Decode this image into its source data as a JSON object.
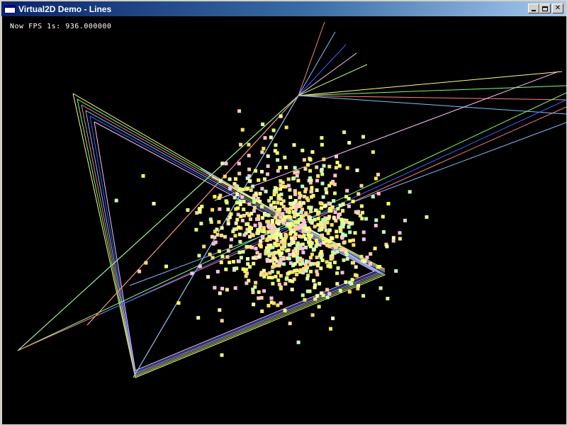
{
  "window": {
    "title": "Virtual2D Demo - Lines",
    "icon": "app-window-icon",
    "buttons": {
      "minimize": "minimize-icon",
      "maximize": "maximize-icon",
      "close": "close-icon"
    }
  },
  "overlay": {
    "fps_text": "Now FPS 1s: 936.000000"
  },
  "colors": {
    "background": "#000000",
    "text": "#ffffff",
    "line_palette": [
      "#ffff80",
      "#80ff80",
      "#ff8080",
      "#80c0ff",
      "#4060ff",
      "#ffc0ff",
      "#c0ff80"
    ],
    "particle_palette": [
      "#ffff66",
      "#ffffaa",
      "#e0ff80",
      "#ffd0a0",
      "#ffc0e0",
      "#c0ffc0",
      "#ffe066"
    ]
  }
}
